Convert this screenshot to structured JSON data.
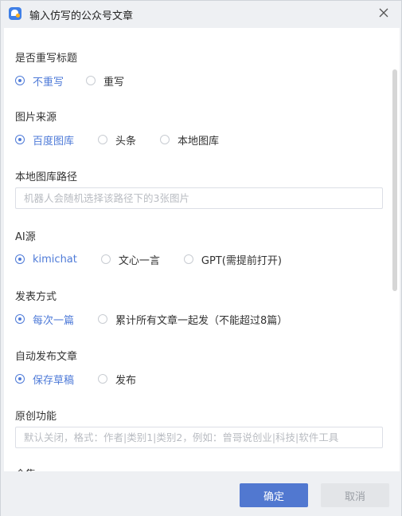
{
  "dialog": {
    "title": "输入仿写的公众号文章",
    "close_icon": "close-icon"
  },
  "sections": [
    {
      "label": "是否重写标题",
      "options": [
        "不重写",
        "重写"
      ],
      "selected": 0
    },
    {
      "label": "图片来源",
      "options": [
        "百度图库",
        "头条",
        "本地图库"
      ],
      "selected": 0
    },
    {
      "label": "本地图库路径",
      "input": {
        "value": "",
        "placeholder": "机器人会随机选择该路径下的3张图片"
      }
    },
    {
      "label": "AI源",
      "options": [
        "kimichat",
        "文心一言",
        "GPT(需提前打开)"
      ],
      "selected": 0
    },
    {
      "label": "发表方式",
      "options": [
        "每次一篇",
        "累计所有文章一起发（不能超过8篇）"
      ],
      "selected": 0
    },
    {
      "label": "自动发布文章",
      "options": [
        "保存草稿",
        "发布"
      ],
      "selected": 0
    },
    {
      "label": "原创功能",
      "input": {
        "value": "",
        "placeholder": "默认关闭，格式：作者|类别1|类别2，例如：曾哥说创业|科技|软件工具"
      }
    },
    {
      "label": "合集"
    }
  ],
  "footer": {
    "ok_label": "确定",
    "cancel_label": "取消"
  },
  "colors": {
    "accent": "#4f7bd8",
    "ok_button": "#5178d0",
    "background": "#eef0f3"
  }
}
